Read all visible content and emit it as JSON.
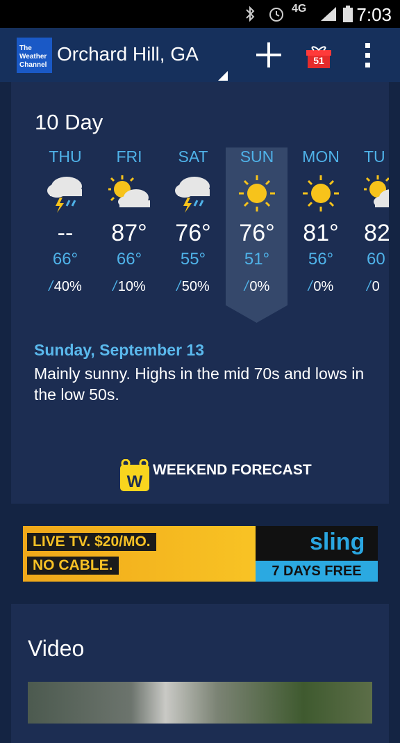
{
  "status_bar": {
    "time": "7:03",
    "network": "4G"
  },
  "app_bar": {
    "logo_lines": [
      "The",
      "Weather",
      "Channel"
    ],
    "location": "Orchard Hill, GA",
    "gift_badge": "51"
  },
  "ten_day": {
    "title": "10 Day",
    "days": [
      {
        "name": "THU",
        "icon": "thunderstorm-icon",
        "high": "--",
        "low": "66°",
        "precip": "40%"
      },
      {
        "name": "FRI",
        "icon": "partly-cloudy-icon",
        "high": "87°",
        "low": "66°",
        "precip": "10%"
      },
      {
        "name": "SAT",
        "icon": "thunderstorm-icon",
        "high": "76°",
        "low": "55°",
        "precip": "50%"
      },
      {
        "name": "SUN",
        "icon": "sunny-icon",
        "high": "76°",
        "low": "51°",
        "precip": "0%"
      },
      {
        "name": "MON",
        "icon": "sunny-icon",
        "high": "81°",
        "low": "56°",
        "precip": "0%"
      },
      {
        "name": "TU",
        "icon": "partly-cloudy-icon",
        "high": "82",
        "low": "60",
        "precip": "0"
      }
    ],
    "selected_index": 3,
    "detail": {
      "date": "Sunday, September 13",
      "text": "Mainly sunny. Highs in the mid 70s and lows in the low 50s."
    },
    "weekend_label": "WEEKEND FORECAST",
    "weekend_icon_letter": "W"
  },
  "ad": {
    "line1": "LIVE TV. $20/MO.",
    "line2": "NO CABLE.",
    "brand": "sling",
    "cta": "7 DAYS FREE"
  },
  "video": {
    "title": "Video"
  },
  "colors": {
    "accent": "#4fb2e8",
    "card": "#1c2d52",
    "appbar": "#16305c"
  }
}
